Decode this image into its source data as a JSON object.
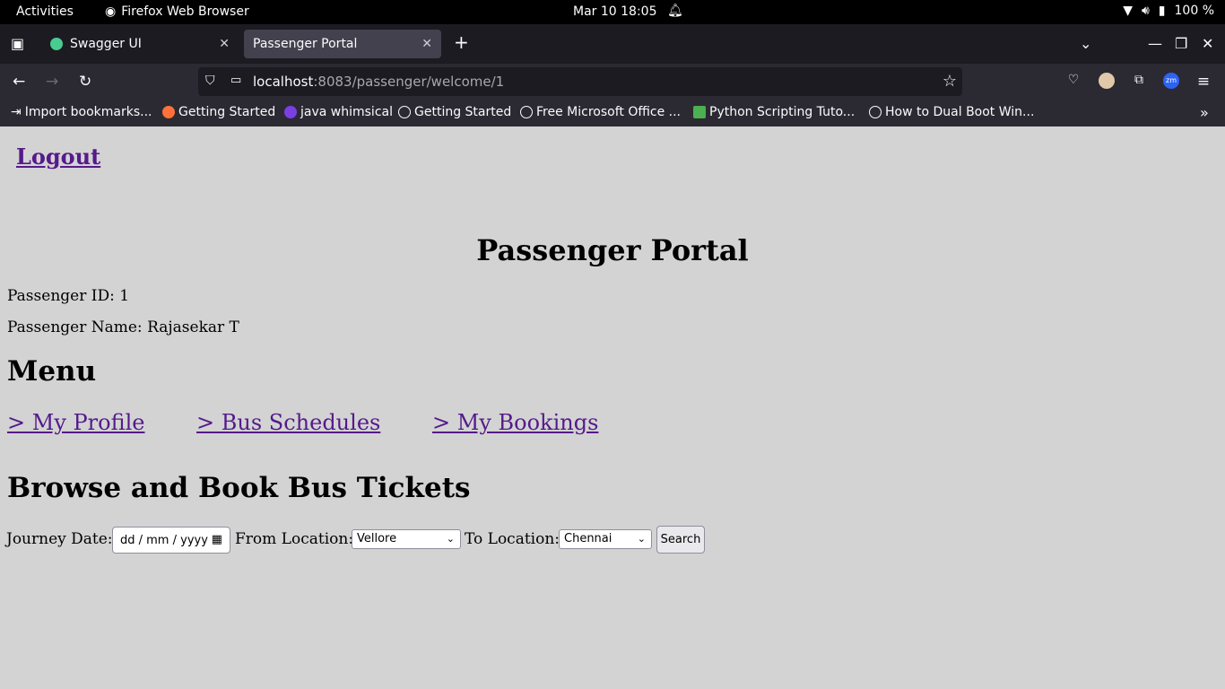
{
  "topbar": {
    "activities": "Activities",
    "app": "Firefox Web Browser",
    "clock": "Mar 10  18:05",
    "battery": "100 %"
  },
  "tabs": [
    {
      "label": "Swagger UI"
    },
    {
      "label": "Passenger Portal"
    }
  ],
  "url": {
    "host": "localhost",
    "rest": ":8083/passenger/welcome/1"
  },
  "bookmarks": [
    {
      "label": "Import bookmarks..."
    },
    {
      "label": "Getting Started"
    },
    {
      "label": "java whimsical"
    },
    {
      "label": "Getting Started"
    },
    {
      "label": "Free Microsoft Office ..."
    },
    {
      "label": "Python Scripting Tuto..."
    },
    {
      "label": "How to Dual Boot Win..."
    }
  ],
  "page": {
    "logout": "Logout",
    "title": "Passenger Portal",
    "passenger_id": "Passenger ID: 1",
    "passenger_name": "Passenger Name: Rajasekar T",
    "menu_heading": "Menu",
    "menu": [
      {
        "label": "> My Profile "
      },
      {
        "label": "> Bus Schedules "
      },
      {
        "label": "> My Bookings"
      }
    ],
    "browse_heading": "Browse and Book Bus Tickets",
    "form": {
      "journey_label": "Journey Date:",
      "date_placeholder": "dd / mm / yyyy",
      "from_label": "From Location:",
      "from_value": "Vellore",
      "to_label": "To Location:",
      "to_value": "Chennai",
      "search": "Search"
    }
  }
}
